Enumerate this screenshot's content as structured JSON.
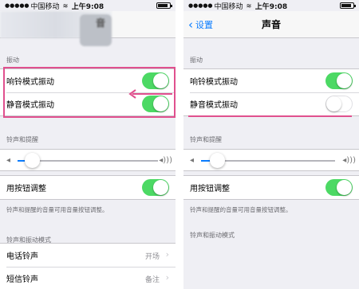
{
  "status_bar": {
    "carrier": "中国移动",
    "time": "上午9:08"
  },
  "left": {
    "nav_title_partial": "音",
    "vibration_header": "振动",
    "vibrate_on_ring_label": "响铃模式振动",
    "vibrate_on_silent_label": "静音模式振动",
    "ringer_header": "铃声和提醒",
    "ringer_volume_fraction": 0.1,
    "change_with_buttons_label": "用按钮调整",
    "change_with_buttons_note": "铃声和提醒的音量可用音量按钮调整。",
    "patterns_header": "铃声和振动模式",
    "phone_ringtone_label": "电话铃声",
    "phone_ringtone_value": "开场",
    "text_tone_label": "短信铃声",
    "text_tone_value": "备注",
    "vibrate_on_ring_state": "on",
    "vibrate_on_silent_state": "on",
    "change_with_buttons_state": "on"
  },
  "right": {
    "back_label": "设置",
    "nav_title": "声音",
    "vibration_header": "振动",
    "vibrate_on_ring_label": "响铃模式振动",
    "vibrate_on_silent_label": "静音模式振动",
    "ringer_header": "铃声和提醒",
    "ringer_volume_fraction": 0.12,
    "change_with_buttons_label": "用按钮调整",
    "change_with_buttons_note": "铃声和提醒的音量可用音量按钮调整。",
    "patterns_header": "铃声和振动模式",
    "vibrate_on_ring_state": "on",
    "vibrate_on_silent_state": "off",
    "change_with_buttons_state": "on"
  },
  "icons": {
    "speaker_low": "speaker-low-icon",
    "speaker_high": "speaker-high-icon",
    "back": "chevron-left-icon",
    "disclosure": "chevron-right-icon",
    "annotation_arrow": "arrow-left-icon"
  },
  "colors": {
    "toggle_on": "#4cd964",
    "ios_blue": "#0a7cff",
    "annotation_pink": "#e0508e"
  }
}
